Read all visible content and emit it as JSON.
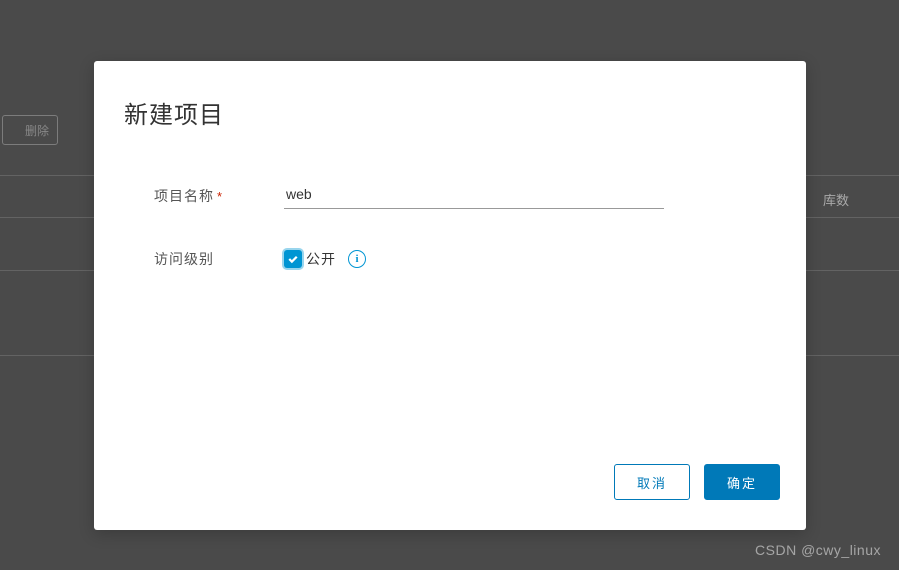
{
  "background": {
    "delete_button": "删除",
    "column_right": "库数"
  },
  "modal": {
    "title": "新建项目",
    "form": {
      "name_label": "项目名称",
      "name_value": "web",
      "access_label": "访问级别",
      "public_label": "公开",
      "public_checked": true
    },
    "footer": {
      "cancel": "取消",
      "confirm": "确定"
    }
  },
  "watermark": "CSDN @cwy_linux"
}
